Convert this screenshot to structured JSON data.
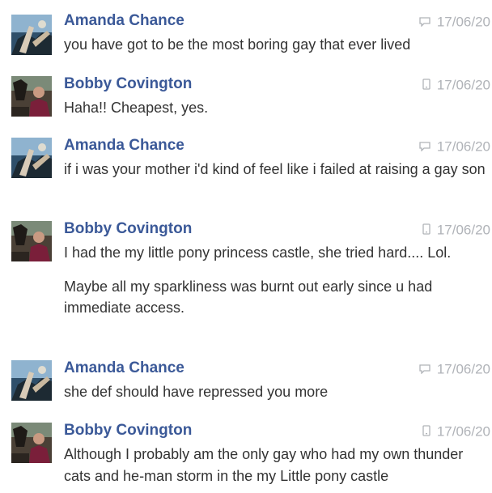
{
  "colors": {
    "name": "#3b5998",
    "text": "#333333",
    "meta": "#b0b3b8"
  },
  "messages": [
    {
      "sender": "Amanda Chance",
      "avatar": "amanda",
      "device": "chat-icon",
      "timestamp": "17/06/20",
      "lines": [
        "you have got to be the most boring gay that ever lived"
      ]
    },
    {
      "sender": "Bobby Covington",
      "avatar": "bobby",
      "device": "mobile-icon",
      "timestamp": "17/06/20",
      "lines": [
        "Haha!! Cheapest, yes."
      ]
    },
    {
      "sender": "Amanda Chance",
      "avatar": "amanda",
      "device": "chat-icon",
      "timestamp": "17/06/20",
      "lines": [
        "if i was your mother i'd kind of feel like i failed at raising a gay son"
      ]
    },
    {
      "sender": "Bobby Covington",
      "avatar": "bobby",
      "device": "mobile-icon",
      "timestamp": "17/06/20",
      "lines": [
        "I had the my little pony princess castle, she tried hard.... Lol.",
        "Maybe all my sparkliness was burnt out early since u had immediate access."
      ]
    },
    {
      "sender": "Amanda Chance",
      "avatar": "amanda",
      "device": "chat-icon",
      "timestamp": "17/06/20",
      "lines": [
        "she def should have repressed you more"
      ]
    },
    {
      "sender": "Bobby Covington",
      "avatar": "bobby",
      "device": "mobile-icon",
      "timestamp": "17/06/20",
      "lines": [
        "Although I probably am the only gay who had my own thunder cats and he-man storm in the my Little pony castle"
      ]
    }
  ]
}
